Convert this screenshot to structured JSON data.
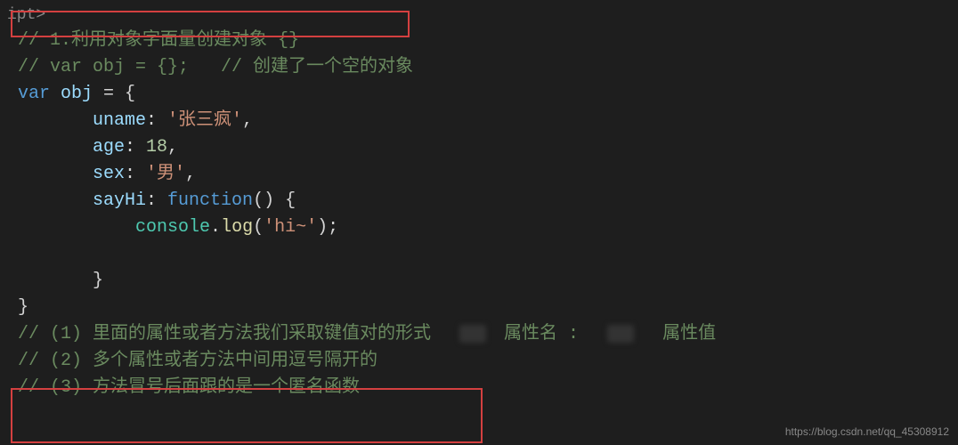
{
  "code": {
    "line0": "ipt>",
    "line1_comment": "// 1.利用对象字面量创建对象 {}",
    "line2_comment": "// var obj = {};   // 创建了一个空的对象",
    "line3_var": "var",
    "line3_obj": " obj ",
    "line3_eq": "= {",
    "line4_prop": "uname",
    "line4_colon": ": ",
    "line4_val": "'张三疯'",
    "line4_comma": ",",
    "line5_prop": "age",
    "line5_colon": ": ",
    "line5_val": "18",
    "line5_comma": ",",
    "line6_prop": "sex",
    "line6_colon": ": ",
    "line6_val": "'男'",
    "line6_comma": ",",
    "line7_prop": "sayHi",
    "line7_colon": ": ",
    "line7_func": "function",
    "line7_paren": "() {",
    "line8_indent": "            ",
    "line8_console": "console",
    "line8_dot": ".",
    "line8_log": "log",
    "line8_open": "(",
    "line8_str": "'hi~'",
    "line8_close": ");",
    "line9": "",
    "line10_close": "        }",
    "line11_close": "}",
    "line12_comment_a": "// (1) 里面的属性或者方法我们采取键值对的形式  ",
    "line12_comment_b": " 属性名 :  ",
    "line12_comment_c": "  属性值",
    "line13_comment": "// (2) 多个属性或者方法中间用逗号隔开的",
    "line14_comment": "// (3) 方法冒号后面跟的是一个匿名函数"
  },
  "watermark": "https://blog.csdn.net/qq_45308912"
}
